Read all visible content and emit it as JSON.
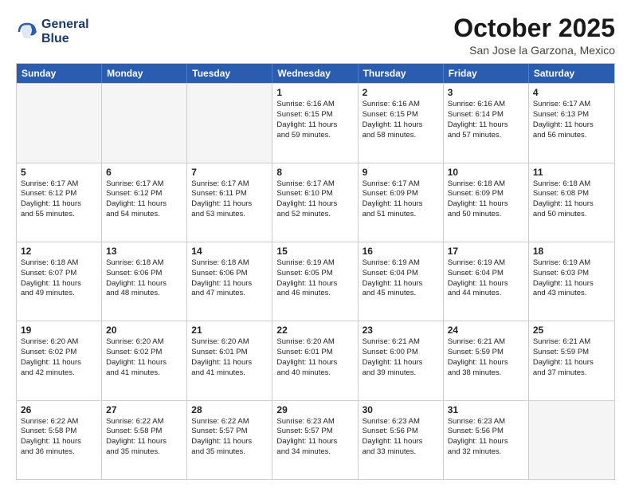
{
  "logo": {
    "line1": "General",
    "line2": "Blue"
  },
  "title": "October 2025",
  "location": "San Jose la Garzona, Mexico",
  "header": {
    "days": [
      "Sunday",
      "Monday",
      "Tuesday",
      "Wednesday",
      "Thursday",
      "Friday",
      "Saturday"
    ]
  },
  "weeks": [
    [
      {
        "day": "",
        "info": ""
      },
      {
        "day": "",
        "info": ""
      },
      {
        "day": "",
        "info": ""
      },
      {
        "day": "1",
        "info": "Sunrise: 6:16 AM\nSunset: 6:15 PM\nDaylight: 11 hours\nand 59 minutes."
      },
      {
        "day": "2",
        "info": "Sunrise: 6:16 AM\nSunset: 6:15 PM\nDaylight: 11 hours\nand 58 minutes."
      },
      {
        "day": "3",
        "info": "Sunrise: 6:16 AM\nSunset: 6:14 PM\nDaylight: 11 hours\nand 57 minutes."
      },
      {
        "day": "4",
        "info": "Sunrise: 6:17 AM\nSunset: 6:13 PM\nDaylight: 11 hours\nand 56 minutes."
      }
    ],
    [
      {
        "day": "5",
        "info": "Sunrise: 6:17 AM\nSunset: 6:12 PM\nDaylight: 11 hours\nand 55 minutes."
      },
      {
        "day": "6",
        "info": "Sunrise: 6:17 AM\nSunset: 6:12 PM\nDaylight: 11 hours\nand 54 minutes."
      },
      {
        "day": "7",
        "info": "Sunrise: 6:17 AM\nSunset: 6:11 PM\nDaylight: 11 hours\nand 53 minutes."
      },
      {
        "day": "8",
        "info": "Sunrise: 6:17 AM\nSunset: 6:10 PM\nDaylight: 11 hours\nand 52 minutes."
      },
      {
        "day": "9",
        "info": "Sunrise: 6:17 AM\nSunset: 6:09 PM\nDaylight: 11 hours\nand 51 minutes."
      },
      {
        "day": "10",
        "info": "Sunrise: 6:18 AM\nSunset: 6:09 PM\nDaylight: 11 hours\nand 50 minutes."
      },
      {
        "day": "11",
        "info": "Sunrise: 6:18 AM\nSunset: 6:08 PM\nDaylight: 11 hours\nand 50 minutes."
      }
    ],
    [
      {
        "day": "12",
        "info": "Sunrise: 6:18 AM\nSunset: 6:07 PM\nDaylight: 11 hours\nand 49 minutes."
      },
      {
        "day": "13",
        "info": "Sunrise: 6:18 AM\nSunset: 6:06 PM\nDaylight: 11 hours\nand 48 minutes."
      },
      {
        "day": "14",
        "info": "Sunrise: 6:18 AM\nSunset: 6:06 PM\nDaylight: 11 hours\nand 47 minutes."
      },
      {
        "day": "15",
        "info": "Sunrise: 6:19 AM\nSunset: 6:05 PM\nDaylight: 11 hours\nand 46 minutes."
      },
      {
        "day": "16",
        "info": "Sunrise: 6:19 AM\nSunset: 6:04 PM\nDaylight: 11 hours\nand 45 minutes."
      },
      {
        "day": "17",
        "info": "Sunrise: 6:19 AM\nSunset: 6:04 PM\nDaylight: 11 hours\nand 44 minutes."
      },
      {
        "day": "18",
        "info": "Sunrise: 6:19 AM\nSunset: 6:03 PM\nDaylight: 11 hours\nand 43 minutes."
      }
    ],
    [
      {
        "day": "19",
        "info": "Sunrise: 6:20 AM\nSunset: 6:02 PM\nDaylight: 11 hours\nand 42 minutes."
      },
      {
        "day": "20",
        "info": "Sunrise: 6:20 AM\nSunset: 6:02 PM\nDaylight: 11 hours\nand 41 minutes."
      },
      {
        "day": "21",
        "info": "Sunrise: 6:20 AM\nSunset: 6:01 PM\nDaylight: 11 hours\nand 41 minutes."
      },
      {
        "day": "22",
        "info": "Sunrise: 6:20 AM\nSunset: 6:01 PM\nDaylight: 11 hours\nand 40 minutes."
      },
      {
        "day": "23",
        "info": "Sunrise: 6:21 AM\nSunset: 6:00 PM\nDaylight: 11 hours\nand 39 minutes."
      },
      {
        "day": "24",
        "info": "Sunrise: 6:21 AM\nSunset: 5:59 PM\nDaylight: 11 hours\nand 38 minutes."
      },
      {
        "day": "25",
        "info": "Sunrise: 6:21 AM\nSunset: 5:59 PM\nDaylight: 11 hours\nand 37 minutes."
      }
    ],
    [
      {
        "day": "26",
        "info": "Sunrise: 6:22 AM\nSunset: 5:58 PM\nDaylight: 11 hours\nand 36 minutes."
      },
      {
        "day": "27",
        "info": "Sunrise: 6:22 AM\nSunset: 5:58 PM\nDaylight: 11 hours\nand 35 minutes."
      },
      {
        "day": "28",
        "info": "Sunrise: 6:22 AM\nSunset: 5:57 PM\nDaylight: 11 hours\nand 35 minutes."
      },
      {
        "day": "29",
        "info": "Sunrise: 6:23 AM\nSunset: 5:57 PM\nDaylight: 11 hours\nand 34 minutes."
      },
      {
        "day": "30",
        "info": "Sunrise: 6:23 AM\nSunset: 5:56 PM\nDaylight: 11 hours\nand 33 minutes."
      },
      {
        "day": "31",
        "info": "Sunrise: 6:23 AM\nSunset: 5:56 PM\nDaylight: 11 hours\nand 32 minutes."
      },
      {
        "day": "",
        "info": ""
      }
    ]
  ]
}
